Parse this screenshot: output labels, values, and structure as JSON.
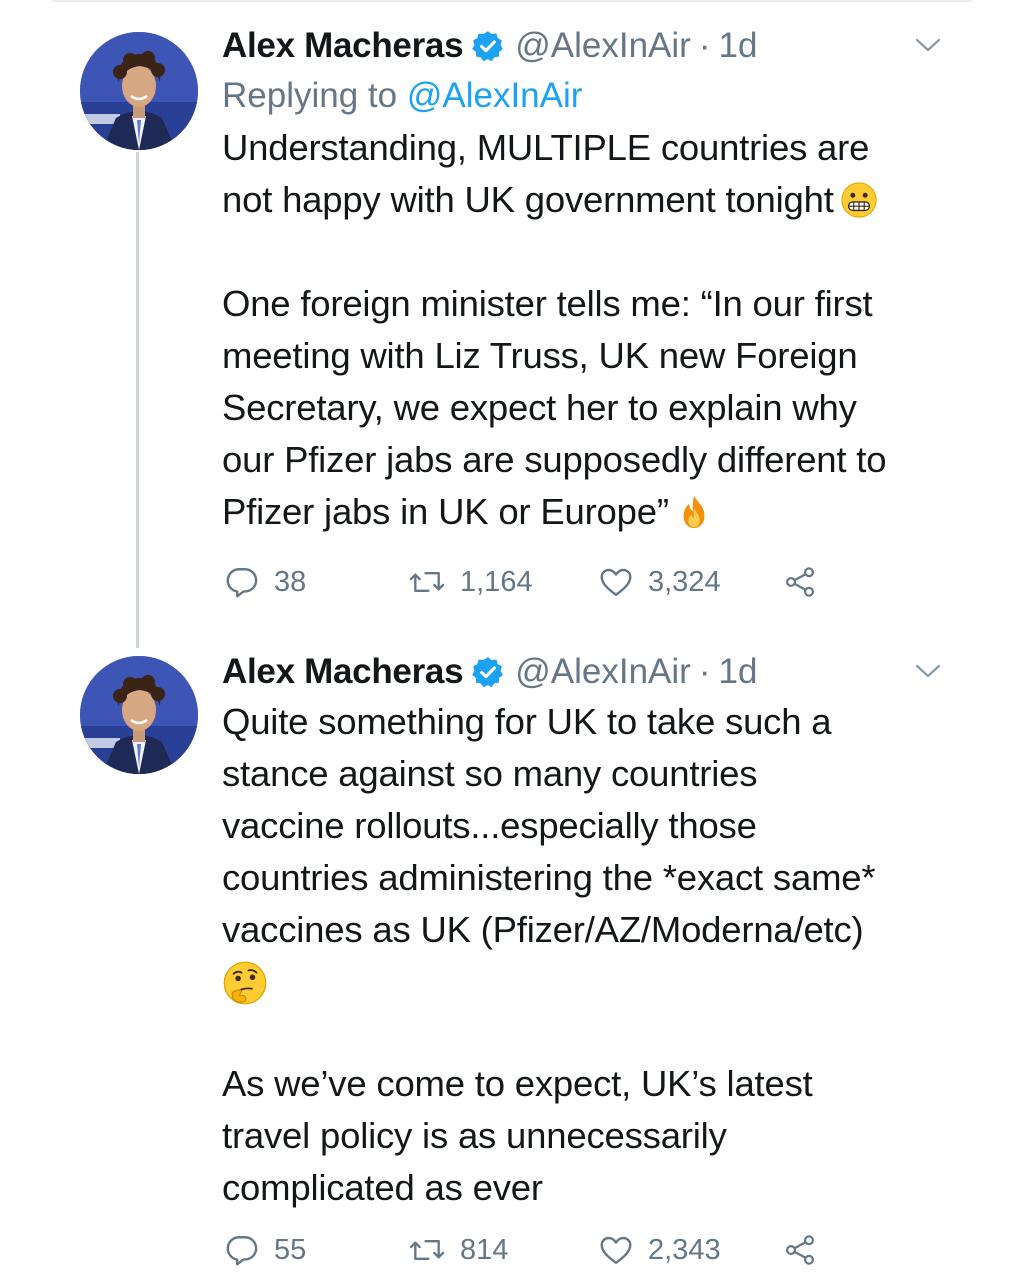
{
  "tweets": [
    {
      "author": {
        "name": "Alex Macheras",
        "handle": "@AlexInAir",
        "verified": true,
        "avatar": "avatar-photo"
      },
      "dot": "·",
      "time": "1d",
      "replying_prefix": "Replying to",
      "replying_handle": "@AlexInAir",
      "paragraphs": [
        [
          "Understanding, MULTIPLE countries are",
          "not happy with UK government tonight"
        ],
        [
          "One foreign minister tells me: “In our first",
          "meeting with Liz Truss, UK new Foreign",
          "Secretary, we expect her to explain why",
          "our Pfizer jabs are supposedly different to",
          "Pfizer jabs in UK or Europe”"
        ]
      ],
      "emojis": [
        "grimacing-face-emoji",
        "fire-emoji"
      ],
      "replies": "38",
      "retweets": "1,164",
      "likes": "3,324"
    },
    {
      "author": {
        "name": "Alex Macheras",
        "handle": "@AlexInAir",
        "verified": true,
        "avatar": "avatar-photo"
      },
      "dot": "·",
      "time": "1d",
      "paragraphs": [
        [
          "Quite something for UK to take such a",
          "stance against so many countries",
          "vaccine rollouts...especially those",
          "countries administering the *exact same*",
          "vaccines as UK (Pfizer/AZ/Moderna/etc)"
        ],
        [
          "As we’ve come to expect, UK’s latest",
          "travel policy is as unnecessarily",
          "complicated as ever"
        ]
      ],
      "emojis": [
        "thinking-face-emoji"
      ],
      "replies": "55",
      "retweets": "814",
      "likes": "2,343"
    }
  ],
  "icons": {
    "reply": "reply-icon",
    "retweet": "retweet-icon",
    "like": "heart-icon",
    "share": "share-icon",
    "caret": "chevron-down-icon",
    "verified": "verified-badge-icon"
  },
  "colors": {
    "text": "#14171a",
    "secondary": "#657786",
    "link": "#1da1f2",
    "verified": "#1da1f2",
    "thread_line": "#ccd6dd"
  }
}
